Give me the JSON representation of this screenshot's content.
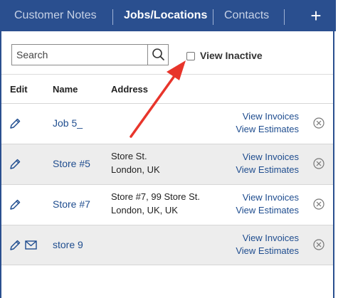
{
  "tabs": [
    {
      "label": "Customer Notes",
      "active": false
    },
    {
      "label": "Jobs/Locations",
      "active": true
    },
    {
      "label": "Contacts",
      "active": false
    }
  ],
  "add_label": "+",
  "search": {
    "placeholder": "Search",
    "value": ""
  },
  "view_inactive": {
    "label": "View Inactive",
    "checked": false
  },
  "table": {
    "columns": {
      "edit": "Edit",
      "name": "Name",
      "address": "Address"
    },
    "rows": [
      {
        "name": "Job 5_",
        "address_line1": "",
        "address_line2": "",
        "link_invoices": "View Invoices",
        "link_estimates": "View Estimates",
        "has_mail": false
      },
      {
        "name": "Store #5",
        "address_line1": "Store St.",
        "address_line2": "London, UK",
        "link_invoices": "View Invoices",
        "link_estimates": "View Estimates",
        "has_mail": false
      },
      {
        "name": "Store #7",
        "address_line1": "Store #7, 99 Store St.",
        "address_line2": "London, UK, UK",
        "link_invoices": "View Invoices",
        "link_estimates": "View Estimates",
        "has_mail": false
      },
      {
        "name": "store 9",
        "address_line1": "",
        "address_line2": "",
        "link_invoices": "View Invoices",
        "link_estimates": "View Estimates",
        "has_mail": true
      }
    ]
  },
  "icons": {
    "add": "plus-icon",
    "search": "search-icon",
    "edit": "pencil-icon",
    "mail": "envelope-icon",
    "delete": "remove-circle-icon",
    "annotation": "red-arrow-annotation"
  },
  "colors": {
    "header_bg": "#2a4f8f",
    "link": "#1f4d8f",
    "alt_row": "#ededed",
    "arrow": "#e8352b"
  }
}
